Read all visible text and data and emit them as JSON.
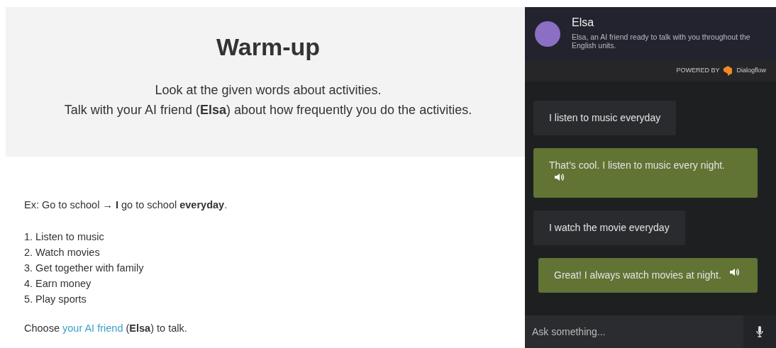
{
  "lesson": {
    "title": "Warm-up",
    "instructions": [
      "Look at the given words about activities.",
      "Talk with your AI friend (**Elsa**) about how frequently you do the activities."
    ],
    "example": "Ex: Go to school → **I** go to school **everyday**.",
    "activities": [
      "1. Listen to music",
      "2. Watch movies",
      "3. Get together with family",
      "4. Earn money",
      "5. Play sports"
    ],
    "choose": {
      "before": "Choose ",
      "link": "your AI friend",
      "after": " (**Elsa**) to talk."
    }
  },
  "chat": {
    "name": "Elsa",
    "description": "Elsa, an AI friend ready to talk with you throughout the English units.",
    "powered_by": "POWERED BY",
    "provider": "Dialogflow",
    "messages": [
      {
        "kind": "user",
        "text": "I listen to music everyday"
      },
      {
        "kind": "bot",
        "text": "That’s cool. I listen to music every night.",
        "audio": true
      },
      {
        "kind": "user",
        "text": "I watch the movie everyday"
      },
      {
        "kind": "bot",
        "text": "Great! I always watch movies at night.",
        "audio": true
      }
    ],
    "input": {
      "placeholder": "Ask something..."
    }
  }
}
